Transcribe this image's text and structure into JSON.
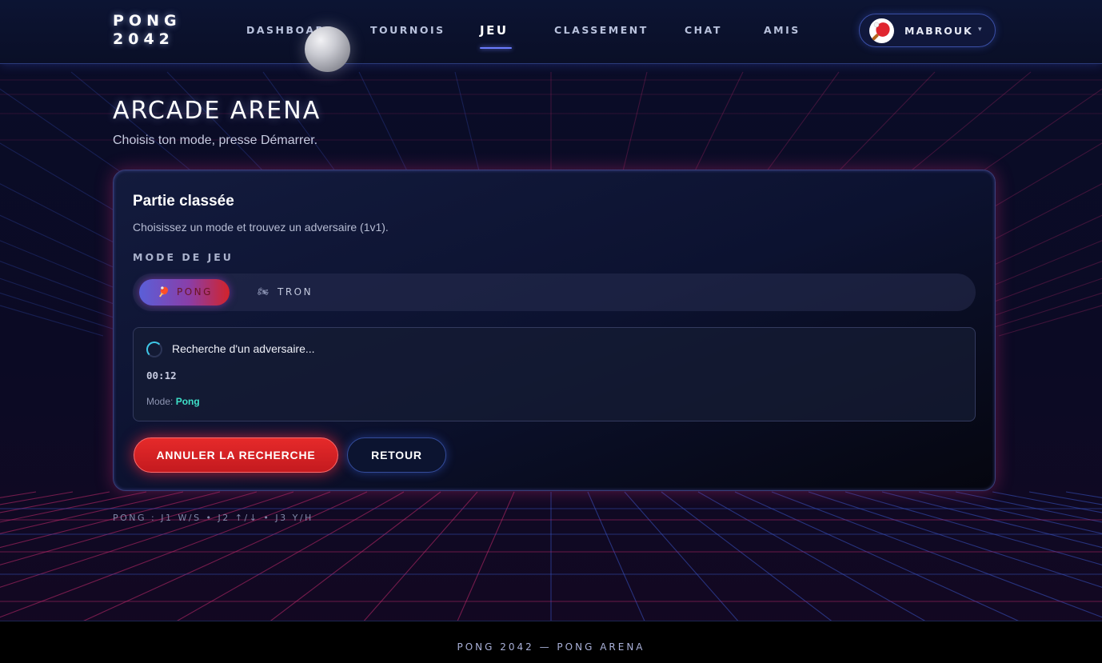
{
  "header": {
    "logo_line1": "PONG",
    "logo_line2": "2042",
    "nav": [
      {
        "label": "DASHBOARD"
      },
      {
        "label": "TOURNOIS"
      },
      {
        "label": "JEU"
      },
      {
        "label": "CLASSEMENT"
      },
      {
        "label": "CHAT"
      },
      {
        "label": "AMIS"
      }
    ],
    "active_nav": "JEU",
    "user": {
      "name": "MABROUK",
      "caret": "▾"
    }
  },
  "page": {
    "title": "ARCADE ARENA",
    "subtitle": "Choisis ton mode, presse Démarrer."
  },
  "card": {
    "title": "Partie classée",
    "description": "Choisissez un mode et trouvez un adversaire (1v1).",
    "mode_section_label": "MODE DE JEU",
    "modes": [
      {
        "label": "PONG",
        "icon": "ping-pong-paddle-icon",
        "selected": true
      },
      {
        "label": "TRON",
        "icon": "light-cycle-icon",
        "selected": false
      }
    ],
    "search": {
      "status": "Recherche d'un adversaire...",
      "timer": "00:12",
      "mode_prefix": "Mode:",
      "mode_value": "Pong"
    },
    "buttons": {
      "cancel": "ANNULER LA RECHERCHE",
      "back": "RETOUR"
    }
  },
  "hint": "PONG : J1 W/S • J2 ↑/↓ • J3 Y/H",
  "footer": "PONG 2042 — PONG ARENA",
  "colors": {
    "background": "#07091d",
    "accent_blue": "#6b7cff",
    "accent_red": "#e62a2a",
    "grid_pink": "#c42a6e",
    "grid_blue": "#3a56c8",
    "mode_highlight": "#3ee0c8"
  }
}
